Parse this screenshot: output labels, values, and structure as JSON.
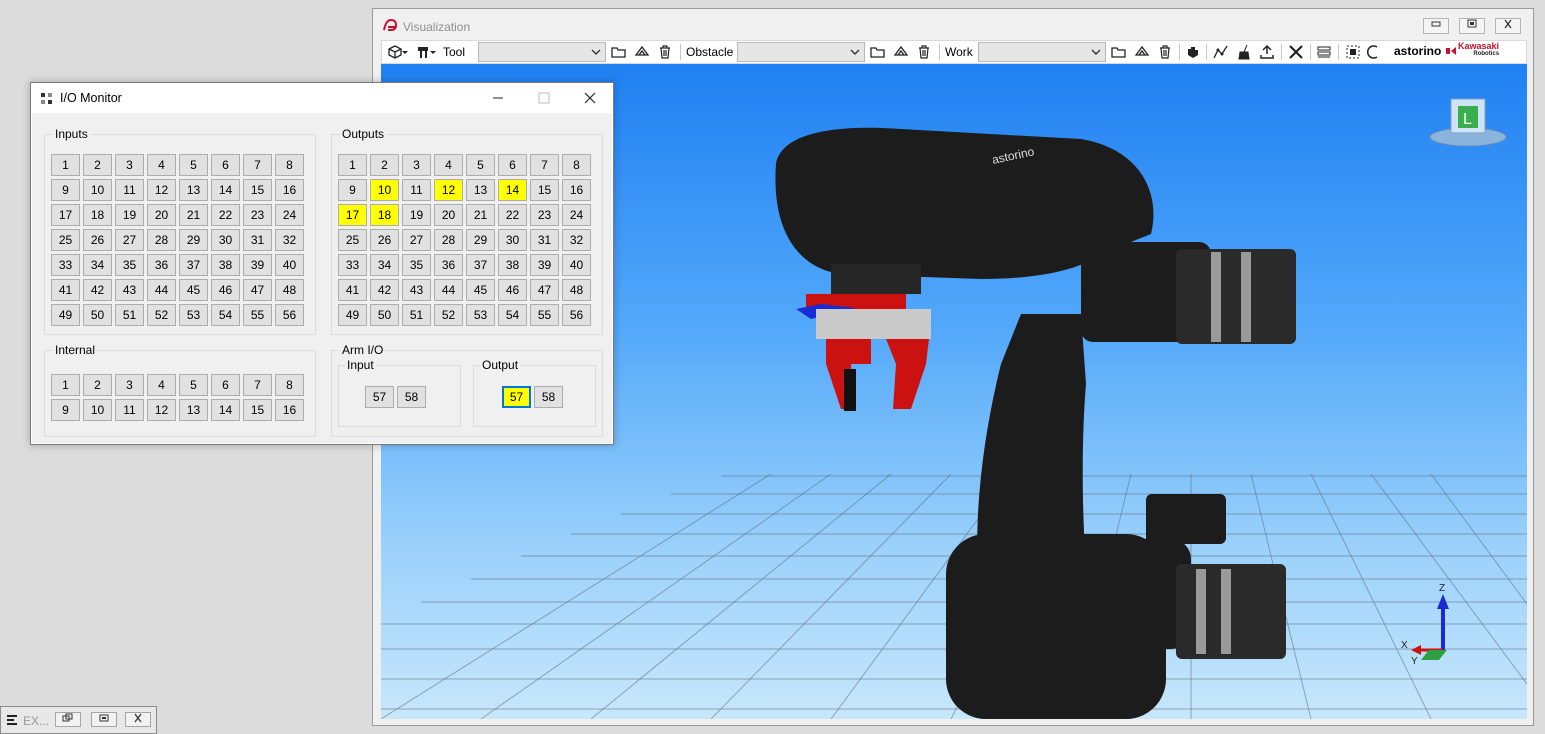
{
  "viz": {
    "title": "Visualization",
    "toolbar": {
      "tool_label": "Tool",
      "obstacle_label": "Obstacle",
      "work_label": "Work",
      "tool_value": "",
      "obstacle_value": "",
      "work_value": "",
      "brand": "astorino",
      "brand_kawasaki": "Kawasaki",
      "brand_robotics": "Robotics"
    },
    "robot_label": "astorino",
    "nav_cube_face": "L",
    "axes": {
      "x": "X",
      "y": "Y",
      "z": "Z"
    }
  },
  "io": {
    "title": "I/O Monitor",
    "inputs_label": "Inputs",
    "outputs_label": "Outputs",
    "internal_label": "Internal",
    "arm_label": "Arm I/O",
    "arm_input_label": "Input",
    "arm_output_label": "Output",
    "inputs": [
      "1",
      "2",
      "3",
      "4",
      "5",
      "6",
      "7",
      "8",
      "9",
      "10",
      "11",
      "12",
      "13",
      "14",
      "15",
      "16",
      "17",
      "18",
      "19",
      "20",
      "21",
      "22",
      "23",
      "24",
      "25",
      "26",
      "27",
      "28",
      "29",
      "30",
      "31",
      "32",
      "33",
      "34",
      "35",
      "36",
      "37",
      "38",
      "39",
      "40",
      "41",
      "42",
      "43",
      "44",
      "45",
      "46",
      "47",
      "48",
      "49",
      "50",
      "51",
      "52",
      "53",
      "54",
      "55",
      "56"
    ],
    "outputs": [
      "1",
      "2",
      "3",
      "4",
      "5",
      "6",
      "7",
      "8",
      "9",
      "10",
      "11",
      "12",
      "13",
      "14",
      "15",
      "16",
      "17",
      "18",
      "19",
      "20",
      "21",
      "22",
      "23",
      "24",
      "25",
      "26",
      "27",
      "28",
      "29",
      "30",
      "31",
      "32",
      "33",
      "34",
      "35",
      "36",
      "37",
      "38",
      "39",
      "40",
      "41",
      "42",
      "43",
      "44",
      "45",
      "46",
      "47",
      "48",
      "49",
      "50",
      "51",
      "52",
      "53",
      "54",
      "55",
      "56"
    ],
    "outputs_on": [
      "10",
      "12",
      "14",
      "17",
      "18"
    ],
    "internal": [
      "1",
      "2",
      "3",
      "4",
      "5",
      "6",
      "7",
      "8",
      "9",
      "10",
      "11",
      "12",
      "13",
      "14",
      "15",
      "16"
    ],
    "arm_inputs": [
      "57",
      "58"
    ],
    "arm_outputs": [
      "57",
      "58"
    ],
    "arm_outputs_on": [
      "57"
    ],
    "highlight_color": "#ffff00"
  },
  "mini": {
    "label": "EX..."
  },
  "colors": {
    "accent": "#0078d7",
    "robot": "#1c1c1c",
    "gripper": "#d40000"
  }
}
